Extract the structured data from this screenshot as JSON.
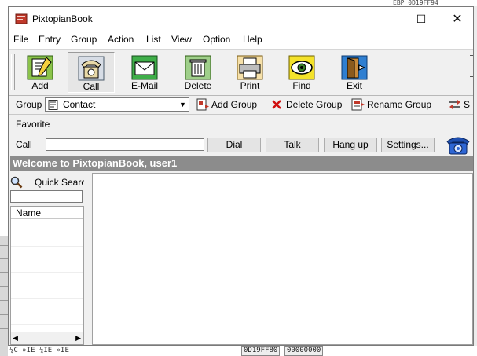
{
  "window": {
    "title": "PixtopianBook"
  },
  "window_controls": {
    "minimize": "—",
    "maximize": "☐",
    "close": "✕"
  },
  "menu": [
    "File",
    "Entry",
    "Group",
    "Action",
    "List",
    "View",
    "Option",
    "Help"
  ],
  "toolbar": [
    {
      "label": "Add",
      "icon": "add-contact-icon"
    },
    {
      "label": "Call",
      "icon": "telephone-icon"
    },
    {
      "label": "E-Mail",
      "icon": "email-icon"
    },
    {
      "label": "Delete",
      "icon": "delete-icon"
    },
    {
      "label": "Print",
      "icon": "printer-icon"
    },
    {
      "label": "Find",
      "icon": "find-eye-icon"
    },
    {
      "label": "Exit",
      "icon": "exit-door-icon"
    }
  ],
  "groupbar": {
    "label": "Group",
    "selected": "Contact",
    "add_group": "Add Group",
    "delete_group": "Delete Group",
    "rename_group": "Rename Group",
    "sort": "S"
  },
  "favorite": {
    "label": "Favorite"
  },
  "callbar": {
    "label": "Call",
    "input_value": "",
    "dial": "Dial",
    "talk": "Talk",
    "hangup": "Hang up",
    "settings": "Settings..."
  },
  "welcome": "Welcome to PixtopianBook, user1",
  "sidebar": {
    "quick_search": "Quick Search",
    "search_value": "",
    "column_name": "Name"
  },
  "background": {
    "top_right": "EBP  0D19FF94",
    "cell1": "0D19FF80",
    "cell2": "00000000",
    "bottom_left": "¼C »IE ¼IE »IE"
  },
  "colors": {
    "welcome_bg": "#8c8c8c",
    "window_bg": "#f0f0f0"
  }
}
